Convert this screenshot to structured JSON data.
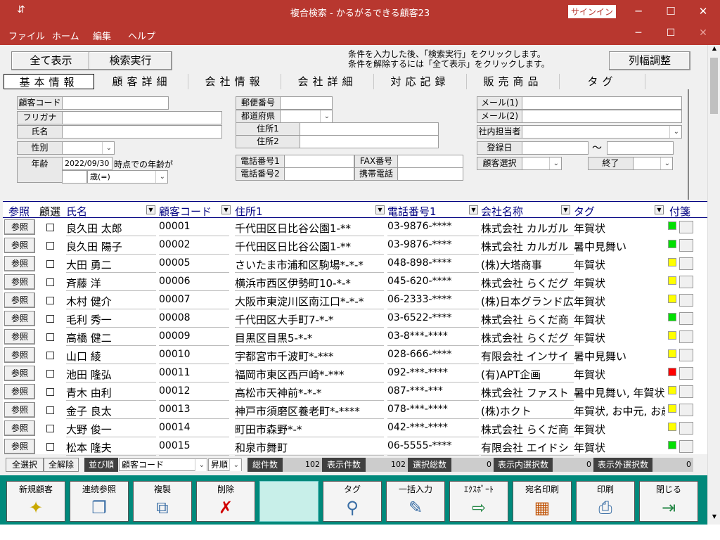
{
  "window": {
    "title": "複合検索 - かるがるできる顧客23",
    "signin": "サインイン",
    "minimize": "─",
    "maximize": "☐",
    "close": "✕",
    "quick": "⇵"
  },
  "menu": [
    "ファイル",
    "ホーム",
    "編集",
    "ヘルプ"
  ],
  "toolbar": {
    "show_all": "全て表示",
    "search": "検索実行",
    "hint1": "条件を入力した後、「検索実行」をクリックします。",
    "hint2": "条件を解除するには「全て表示」をクリックします。",
    "col_adjust": "列幅調整"
  },
  "tabs": [
    "基本情報",
    "顧客詳細",
    "会社情報",
    "会社詳細",
    "対応記録",
    "販売商品",
    "タグ"
  ],
  "form": {
    "customer_code": "顧客コード",
    "furigana": "フリガナ",
    "name": "氏名",
    "gender": "性別",
    "age": "年齢",
    "age_date": "2022/09/30",
    "age_suffix": "時点での年齢が",
    "age_cond": "歳(=)",
    "postal": "郵便番号",
    "prefecture": "都道府県",
    "address1": "住所1",
    "address2": "住所2",
    "tel1": "電話番号1",
    "tel2": "電話番号2",
    "fax": "FAX番号",
    "mobile": "携帯電話",
    "mail1": "メール(1)",
    "mail2": "メール(2)",
    "staff": "社内担当者",
    "reg_date": "登録日",
    "tilde": "〜",
    "select": "顧客選択",
    "end": "終了"
  },
  "columns": {
    "ref": "参照",
    "sel": "顧選",
    "name": "氏名",
    "code": "顧客コード",
    "addr": "住所1",
    "tel": "電話番号1",
    "company": "会社名称",
    "tag": "タグ",
    "memo": "付箋"
  },
  "ref_label": "参照",
  "rows": [
    {
      "name": "良久田 太郎",
      "code": "00001",
      "addr": "千代田区日比谷公園1-**",
      "tel": "03-9876-****",
      "company": "株式会社 カルガル",
      "tag": "年賀状",
      "color": "#00e000"
    },
    {
      "name": "良久田 陽子",
      "code": "00002",
      "addr": "千代田区日比谷公園1-**",
      "tel": "03-9876-****",
      "company": "株式会社 カルガル",
      "tag": "暑中見舞い",
      "color": "#00e000"
    },
    {
      "name": "大田 勇二",
      "code": "00005",
      "addr": "さいたま市浦和区駒場*-*-*",
      "tel": "048-898-****",
      "company": "(株)大塔商事",
      "tag": "年賀状",
      "color": "#ffff00"
    },
    {
      "name": "斉藤 洋",
      "code": "00006",
      "addr": "横浜市西区伊勢町10-*-*",
      "tel": "045-620-****",
      "company": "株式会社 らくだグ",
      "tag": "年賀状",
      "color": "#ffff00"
    },
    {
      "name": "木村 健介",
      "code": "00007",
      "addr": "大阪市東淀川区南江口*-*-*",
      "tel": "06-2333-****",
      "company": "(株)日本グランド広",
      "tag": "年賀状",
      "color": "#ffff00"
    },
    {
      "name": "毛利 秀一",
      "code": "00008",
      "addr": "千代田区大手町7-*-*",
      "tel": "03-6522-****",
      "company": "株式会社 らくだ商",
      "tag": "年賀状",
      "color": "#00e000"
    },
    {
      "name": "高橋 健二",
      "code": "00009",
      "addr": "目黒区目黒5-*-*",
      "tel": "03-8***-****",
      "company": "株式会社 らくだグ",
      "tag": "年賀状",
      "color": "#ffff00"
    },
    {
      "name": "山口 綾",
      "code": "00010",
      "addr": "宇都宮市千波町*-***",
      "tel": "028-666-****",
      "company": "有限会社 インサイ",
      "tag": "暑中見舞い",
      "color": "#ffff00"
    },
    {
      "name": "池田 隆弘",
      "code": "00011",
      "addr": "福岡市東区西戸崎*-***",
      "tel": "092-***-****",
      "company": "(有)APT企画",
      "tag": "年賀状",
      "color": "#ff0000"
    },
    {
      "name": "青木 由利",
      "code": "00012",
      "addr": "高松市天神前*-*-*",
      "tel": "087-***-***",
      "company": "株式会社 ファスト",
      "tag": "暑中見舞い, 年賀状",
      "color": "#ffff00"
    },
    {
      "name": "金子 良太",
      "code": "00013",
      "addr": "神戸市須磨区養老町*-****",
      "tel": "078-***-****",
      "company": "(株)ホクト",
      "tag": "年賀状, お中元, お歳暮",
      "color": "#ffff00"
    },
    {
      "name": "大野 俊一",
      "code": "00014",
      "addr": "町田市森野*-*",
      "tel": "042-***-****",
      "company": "株式会社 らくだ商",
      "tag": "年賀状",
      "color": "#ffff00"
    },
    {
      "name": "松本 隆夫",
      "code": "00015",
      "addr": "和泉市舞町",
      "tel": "06-5555-****",
      "company": "有限会社 エイドシ",
      "tag": "年賀状",
      "color": "#00e000"
    }
  ],
  "status": {
    "select_all": "全選択",
    "deselect_all": "全解除",
    "sort": "並び順",
    "sort_key": "顧客コード",
    "order": "昇順",
    "total_label": "総件数",
    "total": "102",
    "shown_label": "表示件数",
    "shown": "102",
    "selected_label": "選択総数",
    "selected": "0",
    "in_label": "表示内選択数",
    "in": "0",
    "out_label": "表示外選択数",
    "out": "0"
  },
  "actions": [
    {
      "label": "新規顧客",
      "icon": "✦"
    },
    {
      "label": "連続参照",
      "icon": "❐"
    },
    {
      "label": "複製",
      "icon": "⧉"
    },
    {
      "label": "削除",
      "icon": "✗"
    },
    {
      "label": "",
      "icon": ""
    },
    {
      "label": "タグ",
      "icon": "⚲"
    },
    {
      "label": "一括入力",
      "icon": "✎"
    },
    {
      "label": "ｴｸｽﾎﾟｰﾄ",
      "icon": "⇨"
    },
    {
      "label": "宛名印刷",
      "icon": "▦"
    },
    {
      "label": "印刷",
      "icon": "⎙"
    },
    {
      "label": "閉じる",
      "icon": "⇥"
    }
  ]
}
